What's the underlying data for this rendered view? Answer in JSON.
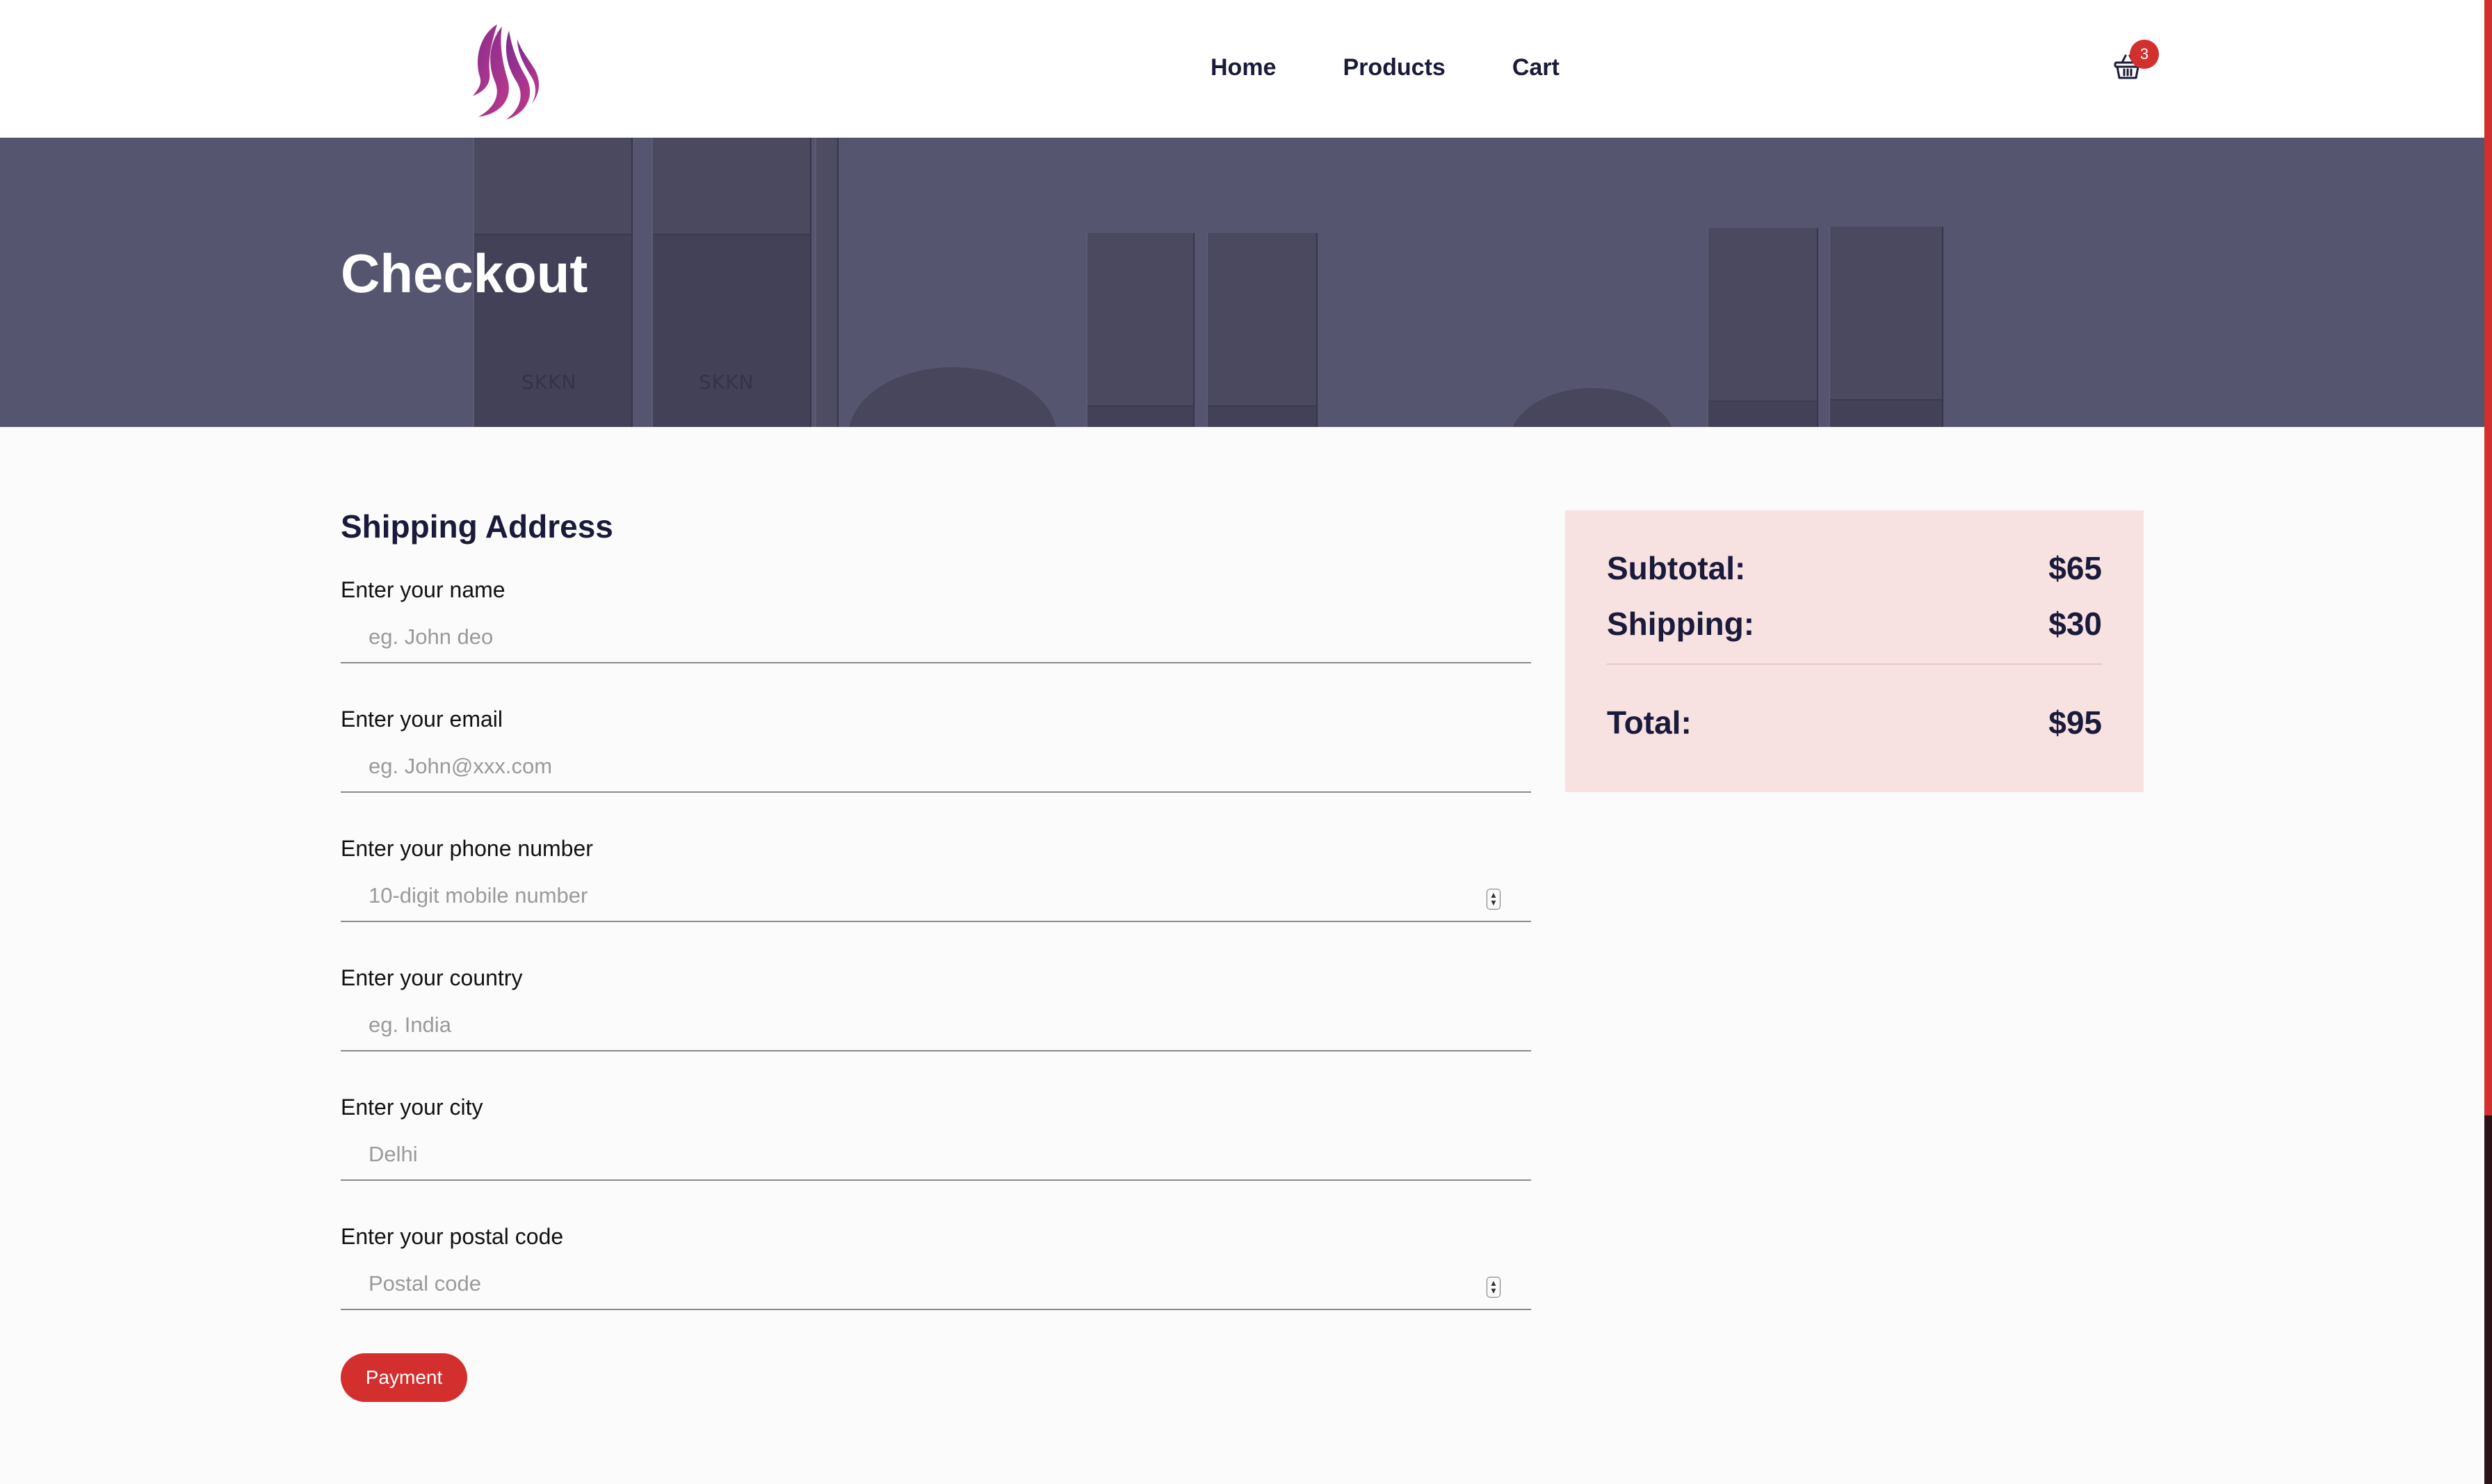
{
  "header": {
    "logo_icon": "woman-hair-silhouette-logo",
    "nav": [
      {
        "label": "Home"
      },
      {
        "label": "Products"
      },
      {
        "label": "Cart"
      }
    ],
    "cart_icon": "shopping-basket-icon",
    "cart_count": "3"
  },
  "banner": {
    "title": "Checkout",
    "product_brand": "SKKN"
  },
  "form": {
    "title": "Shipping Address",
    "fields": [
      {
        "label": "Enter your name",
        "placeholder": "eg. John deo",
        "type": "text"
      },
      {
        "label": "Enter your email",
        "placeholder": "eg. John@xxx.com",
        "type": "email"
      },
      {
        "label": "Enter your phone number",
        "placeholder": "10-digit mobile number",
        "type": "number"
      },
      {
        "label": "Enter your country",
        "placeholder": "eg. India",
        "type": "text"
      },
      {
        "label": "Enter your city",
        "placeholder": "Delhi",
        "type": "text"
      },
      {
        "label": "Enter your postal code",
        "placeholder": "Postal code",
        "type": "number"
      }
    ],
    "submit_label": "Payment"
  },
  "summary": {
    "subtotal_label": "Subtotal:",
    "subtotal_value": "$65",
    "shipping_label": "Shipping:",
    "shipping_value": "$30",
    "total_label": "Total:",
    "total_value": "$95"
  },
  "colors": {
    "accent": "#d32f2f",
    "text_dark": "#1a1a3a",
    "summary_bg": "#f8e1e1",
    "banner_overlay": "#555570"
  }
}
